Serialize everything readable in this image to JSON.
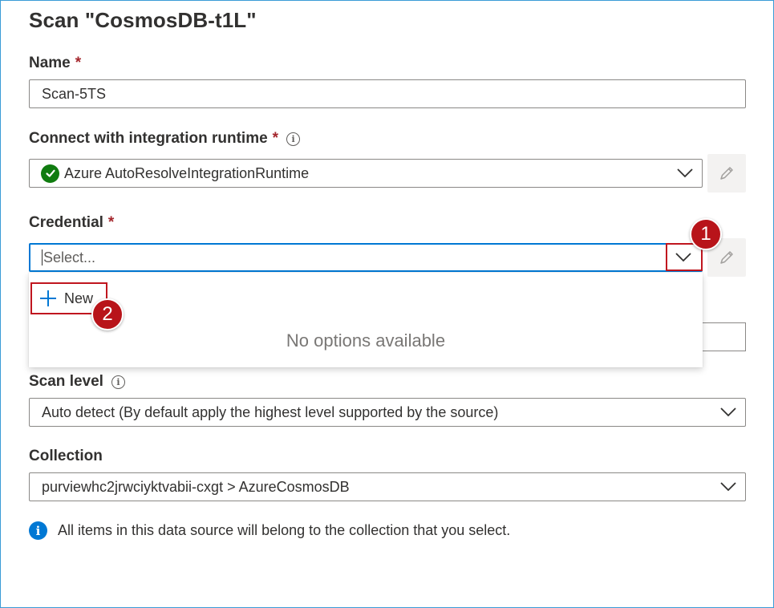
{
  "title": "Scan \"CosmosDB-t1L\"",
  "required_marker": "*",
  "name": {
    "label": "Name",
    "value": "Scan-5TS"
  },
  "runtime": {
    "label": "Connect with integration runtime",
    "value": "Azure AutoResolveIntegrationRuntime",
    "status_icon": "check-circle-icon",
    "status_color": "#107c10"
  },
  "credential": {
    "label": "Credential",
    "placeholder": "Select...",
    "dropdown": {
      "new_label": "New",
      "empty_text": "No options available"
    }
  },
  "scan_level": {
    "label": "Scan level",
    "value": "Auto detect (By default apply the highest level supported by the source)"
  },
  "collection": {
    "label": "Collection",
    "value": "purviewhc2jrwciyktvabii-cxgt > AzureCosmosDB"
  },
  "note": {
    "text": "All items in this data source will belong to the collection that you select."
  },
  "annotations": {
    "step1": "1",
    "step2": "2",
    "color": "#b8141a"
  },
  "accent": "#0078d4"
}
